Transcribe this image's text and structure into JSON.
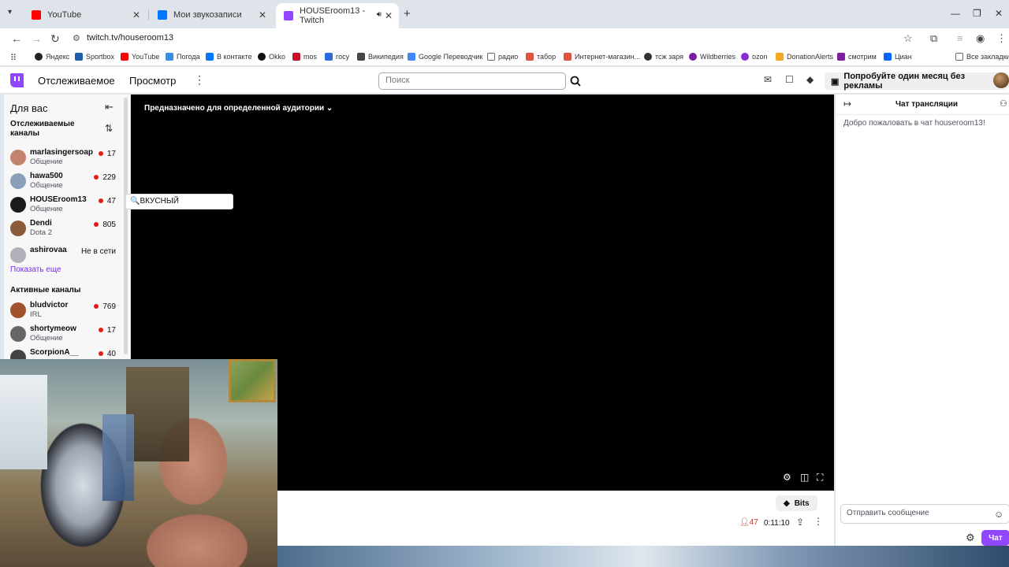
{
  "browser": {
    "tabs": [
      {
        "title": "YouTube",
        "color": "#ff0000"
      },
      {
        "title": "Мои звукозаписи",
        "color": "#0077ff"
      },
      {
        "title": "HOUSEroom13 - Twitch",
        "color": "#9146ff"
      }
    ],
    "url": "twitch.tv/houseroom13",
    "bookmarks": [
      {
        "label": "Яндекс",
        "color": "#222222"
      },
      {
        "label": "Sportbox",
        "color": "#1f5fa8"
      },
      {
        "label": "YouTube",
        "color": "#ff0000"
      },
      {
        "label": "Погода",
        "color": "#3a8ee6"
      },
      {
        "label": "В контакте",
        "color": "#0077ff"
      },
      {
        "label": "Okko",
        "color": "#111111"
      },
      {
        "label": "mos",
        "color": "#c8102e"
      },
      {
        "label": "госу",
        "color": "#2d6cdf"
      },
      {
        "label": "Википедия",
        "color": "#444444"
      },
      {
        "label": "Google Переводчик",
        "color": "#4285f4"
      },
      {
        "label": "радио",
        "color": "#666666"
      },
      {
        "label": "табор",
        "color": "#e0533d"
      },
      {
        "label": "Интернет-магазин...",
        "color": "#e0533d"
      },
      {
        "label": "тсж заря",
        "color": "#333333"
      },
      {
        "label": "Wildberries",
        "color": "#7a1fa2"
      },
      {
        "label": "ozon",
        "color": "#8b2bd6"
      },
      {
        "label": "DonationAlerts",
        "color": "#f5a623"
      },
      {
        "label": "смотрим",
        "color": "#7a1fa2"
      },
      {
        "label": "Циан",
        "color": "#0468ff"
      }
    ],
    "all_bookmarks": "Все закладки"
  },
  "header": {
    "nav_following": "Отслеживаемое",
    "nav_browse": "Просмотр",
    "search_placeholder": "Поиск",
    "promo": "Попробуйте один месяц без рекламы",
    "brand_color": "#9146ff"
  },
  "sidebar": {
    "title": "Для вас",
    "followed_section": "Отслеживаемые каналы",
    "followed": [
      {
        "name": "marlasingersoap",
        "category": "Общение",
        "viewers": "17",
        "avatar_color": "#c4836b"
      },
      {
        "name": "hawa500",
        "category": "Общение",
        "viewers": "229",
        "avatar_color": "#8aa0b8"
      },
      {
        "name": "HOUSEroom13",
        "category": "Общение",
        "viewers": "47",
        "avatar_color": "#1a1a1a"
      },
      {
        "name": "Dendi",
        "category": "Dota 2",
        "viewers": "805",
        "avatar_color": "#8a5a3a"
      },
      {
        "name": "ashirovaa",
        "category": "",
        "status": "Не в сети",
        "avatar_color": "#b0b0b8"
      }
    ],
    "show_more": "Показать еще",
    "active_section": "Активные каналы",
    "active": [
      {
        "name": "bludvictor",
        "category": "IRL",
        "viewers": "769",
        "avatar_color": "#a0522d"
      },
      {
        "name": "shortymeow",
        "category": "Общение",
        "viewers": "17",
        "avatar_color": "#666666"
      },
      {
        "name": "ScorpionA__",
        "category": "",
        "viewers": "40",
        "avatar_color": "#444444"
      }
    ]
  },
  "tooltip": "🔍ВКУСНЫЙ",
  "player": {
    "audience_label": "Предназначено для определенной аудитории"
  },
  "below_player": {
    "bits": "Bits",
    "viewers": "47",
    "uptime": "0:11:10"
  },
  "chat": {
    "title": "Чат трансляции",
    "welcome": "Добро пожаловать в чат houseroom13!",
    "input_placeholder": "Отправить сообщение",
    "send_label": "Чат"
  }
}
